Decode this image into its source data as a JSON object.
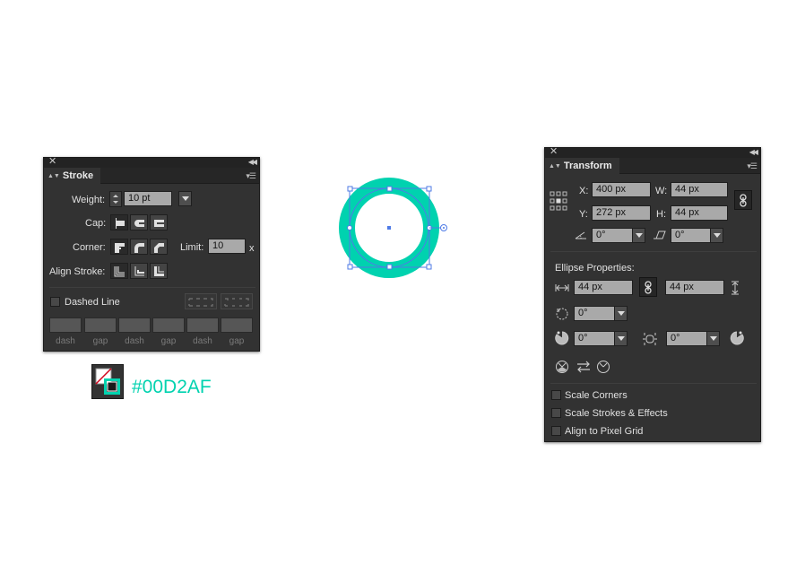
{
  "stroke_panel": {
    "tab_title": "Stroke",
    "weight_label": "Weight:",
    "weight_value": "10 pt",
    "cap_label": "Cap:",
    "corner_label": "Corner:",
    "limit_label": "Limit:",
    "limit_value": "10",
    "limit_unit": "x",
    "align_label": "Align Stroke:",
    "dashed_line_label": "Dashed Line",
    "dash_labels": [
      "dash",
      "gap",
      "dash",
      "gap",
      "dash",
      "gap"
    ]
  },
  "swatch": {
    "hex": "#00D2AF",
    "color": "#00d2af"
  },
  "transform_panel": {
    "tab_title": "Transform",
    "x_label": "X:",
    "x_value": "400 px",
    "y_label": "Y:",
    "y_value": "272 px",
    "w_label": "W:",
    "w_value": "44 px",
    "h_label": "H:",
    "h_value": "44 px",
    "rotate_value": "0°",
    "shear_value": "0°",
    "ellipse_heading": "Ellipse Properties:",
    "ellipse_width": "44 px",
    "ellipse_height": "44 px",
    "ellipse_angle": "0°",
    "pie_start": "0°",
    "pie_end": "0°",
    "scale_corners": "Scale Corners",
    "scale_strokes": "Scale Strokes & Effects",
    "align_pixel": "Align to Pixel Grid"
  }
}
